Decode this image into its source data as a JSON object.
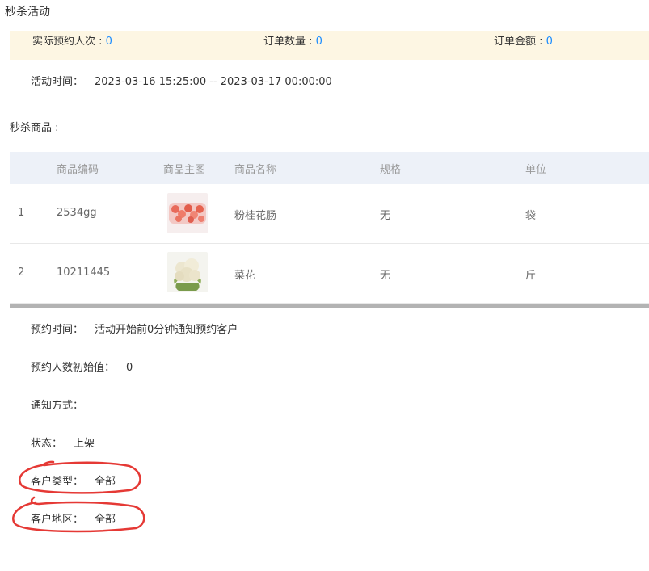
{
  "page": {
    "title": "秒杀活动"
  },
  "stats": {
    "booked_label": "实际预约人次 : ",
    "booked_value": "0",
    "orders_label": "订单数量 : ",
    "orders_value": "0",
    "amount_label": "订单金额 : ",
    "amount_value": "0",
    "value_color": "#1a8cff",
    "bar_bg": "#fdf6e3"
  },
  "activity_time": {
    "label": "活动时间：",
    "value": "2023-03-16 15:25:00 -- 2023-03-17 00:00:00"
  },
  "products": {
    "section_label": "秒杀商品 :",
    "columns": [
      "商品编码",
      "商品主图",
      "商品名称",
      "规格",
      "单位"
    ],
    "rows": [
      {
        "index": "1",
        "code": "2534gg",
        "image": "sausage-photo",
        "name": "粉桂花肠",
        "spec": "无",
        "unit": "袋"
      },
      {
        "index": "2",
        "code": "10211445",
        "image": "cauliflower-photo",
        "name": "菜花",
        "spec": "无",
        "unit": "斤"
      }
    ]
  },
  "details": {
    "reserve_time": {
      "label": "预约时间：",
      "value": "活动开始前0分钟通知预约客户"
    },
    "initial_count": {
      "label": "预约人数初始值：",
      "value": "0"
    },
    "notify_method": {
      "label": "通知方式：",
      "value": ""
    },
    "status": {
      "label": "状态：",
      "value": "上架"
    },
    "customer_type": {
      "label": "客户类型：",
      "value": "全部"
    },
    "customer_region": {
      "label": "客户地区：",
      "value": "全部"
    }
  },
  "annotation_color": "#e53935"
}
